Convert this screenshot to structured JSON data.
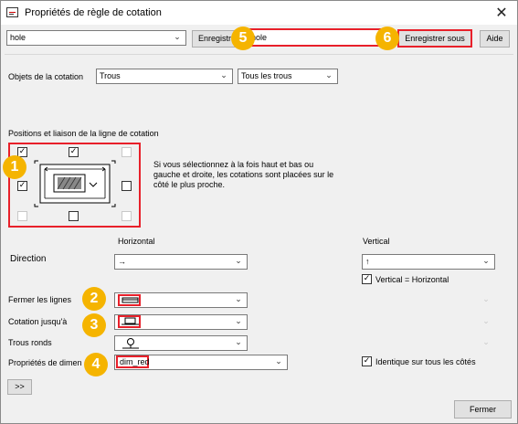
{
  "window": {
    "title": "Propriétés de règle de cotation",
    "close_glyph": "✕"
  },
  "toolbar": {
    "rule_combo_value": "hole",
    "save_label": "Enregistrer",
    "save_name_value": "hole",
    "save_as_label": "Enregistrer sous",
    "help_label": "Aide"
  },
  "objects": {
    "label": "Objets de la cotation",
    "type_value": "Trous",
    "filter_value": "Tous les trous"
  },
  "positions": {
    "title": "Positions et liaison de la ligne de cotation",
    "checkboxes": {
      "top_left": true,
      "top_center": true,
      "top_right": false,
      "middle_left": true,
      "middle_right": false,
      "bottom_left": false,
      "bottom_center": false,
      "bottom_right": false
    },
    "check_glyph": "✓",
    "description": "Si vous sélectionnez à la fois haut et bas ou gauche et droite, les cotations sont placées sur le côté le plus proche."
  },
  "direction": {
    "label": "Direction",
    "horizontal_header": "Horizontal",
    "vertical_header": "Vertical",
    "horizontal_value": "→",
    "vertical_value": "↑",
    "vertical_equals_label": "Vertical = Horizontal",
    "vertical_equals_checked": true
  },
  "fields": {
    "close_lines_label": "Fermer les lignes",
    "dimension_to_label": "Cotation jusqu'à",
    "round_holes_label": "Trous ronds",
    "dimension_props_label": "Propriétés de dimen",
    "dimension_props_value": "dim_red",
    "same_all_sides_label": "Identique sur tous les côtés",
    "same_all_sides_checked": true
  },
  "footer": {
    "expand_label": ">>",
    "close_label": "Fermer"
  },
  "badges": [
    "1",
    "2",
    "3",
    "4",
    "5",
    "6"
  ],
  "colors": {
    "highlight": "#e8202a",
    "badge": "#f5b400"
  }
}
